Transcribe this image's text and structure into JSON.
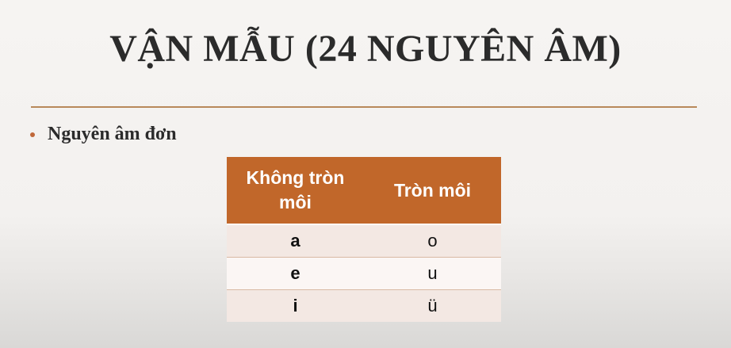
{
  "slide": {
    "title": "VẬN MẪU (24 NGUYÊN ÂM)",
    "bullet": "Nguyên âm đơn"
  },
  "table": {
    "headers": [
      "Không tròn môi",
      "Tròn môi"
    ],
    "rows": [
      [
        "a",
        "o"
      ],
      [
        "e",
        "u"
      ],
      [
        "i",
        "ü"
      ]
    ]
  },
  "colors": {
    "header_bg": "#c1672a",
    "rule": "#b8895a",
    "bullet": "#c0683a"
  }
}
